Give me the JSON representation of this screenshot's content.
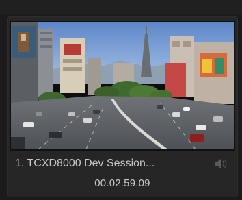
{
  "clip": {
    "title": "1. TCXD8000 Dev Session...",
    "timecode": "00.02.59.09",
    "thumbnail": "city-street-thumbnail",
    "audio_icon": "speaker-icon"
  },
  "colors": {
    "background": "#1b1b1b",
    "card": "#262626",
    "text": "#c9c9c9"
  }
}
